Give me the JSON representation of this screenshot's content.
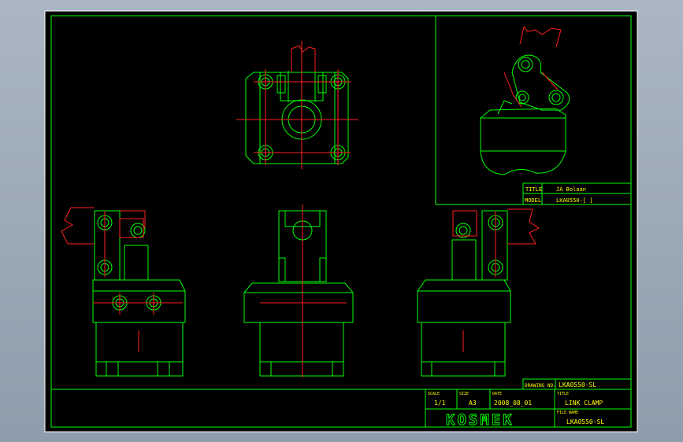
{
  "drawing": {
    "title_label": "TITLE",
    "title_value": "JA Bolaan",
    "model_label": "MODEL",
    "model_value": "LKA0550-[ ]",
    "drawing_no_label": "DRAWING NO.",
    "drawing_no": "LKA0550-SL",
    "scale_label": "SCALE",
    "scale": "1/1",
    "size_label": "SIZE",
    "size": "A3",
    "date_label": "DATE",
    "date": "2008_08_01",
    "name_label": "TITLE",
    "name": "LINK CLAMP",
    "file_label": "FILE NAME",
    "file_name": "LKA0550-SL",
    "brand": "KOSMEK"
  },
  "colors": {
    "background": "#000000",
    "frame_line": "#00ff00",
    "center_line": "#ff2020",
    "border": "#ffffff"
  }
}
